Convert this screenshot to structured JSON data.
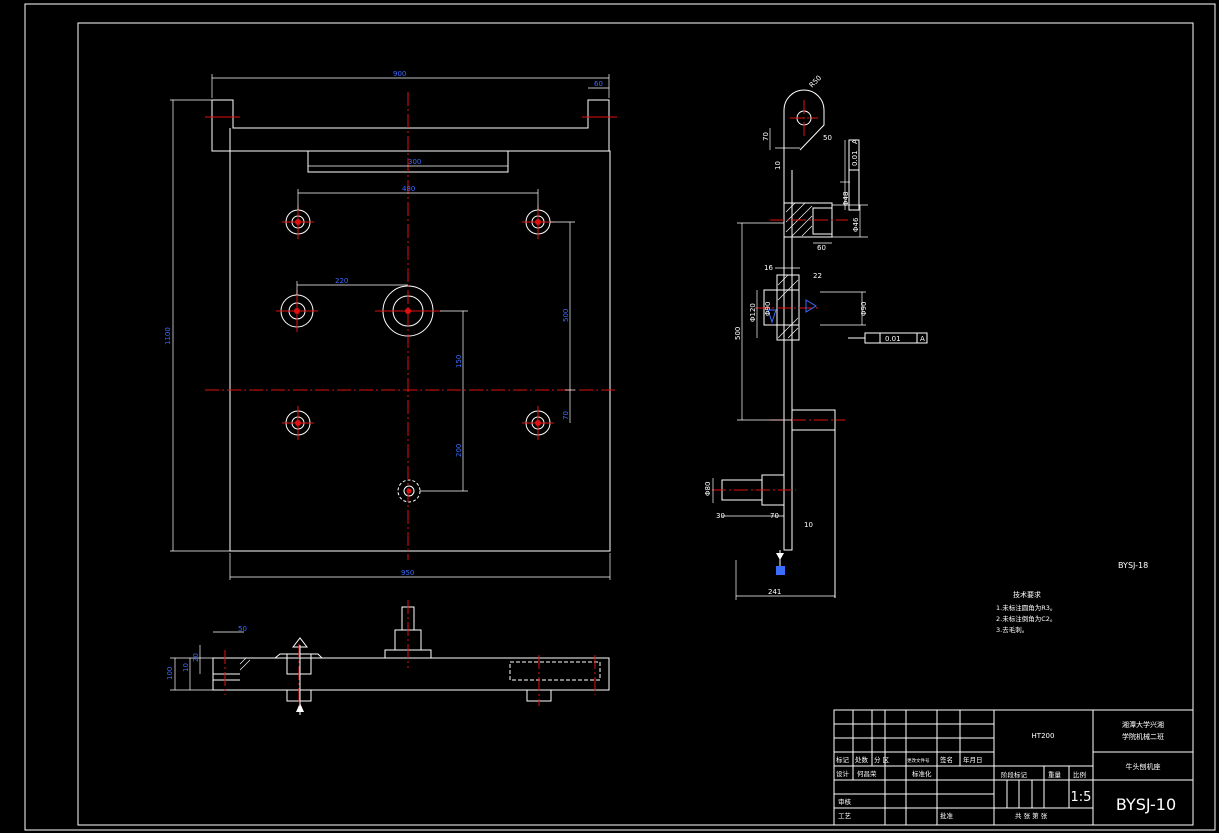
{
  "drawing": {
    "code_right": "BYSJ-18",
    "drawing_number": "BYSJ-10",
    "scale": "1:5",
    "material": "HT200",
    "part_name": "牛头刨机座",
    "school_line1": "湘潭大学兴湘",
    "school_line2": "学院机械二班"
  },
  "notes": {
    "title": "技术要求",
    "items": [
      "1.未标注圆角为R3。",
      "2.未标注倒角为C2。",
      "3.去毛刺。"
    ]
  },
  "title_block": {
    "row1": [
      "标记",
      "处数",
      "分 区",
      "更改文件号",
      "签名",
      "年月日"
    ],
    "row2": [
      "设计",
      "何昌荣",
      "标准化"
    ],
    "stage_headers": [
      "阶段标记",
      "重量",
      "比例"
    ],
    "review": "审核",
    "process": "工艺",
    "approve": "批准",
    "sheets": "共 张  第 张"
  },
  "dimensions": {
    "front_width_top": "900",
    "front_notch": "60",
    "front_width_bottom": "950",
    "front_height": "1100",
    "slot_width": "300",
    "hole_span": "480",
    "bore_offset": "220",
    "right_vert": "500",
    "right_small": "70",
    "mid_vert1": "150",
    "mid_vert2": "200"
  },
  "side_dims": {
    "r_top": "R50",
    "d70": "70",
    "d50": "50",
    "d10": "10",
    "d48": "Φ48",
    "d46": "Φ46",
    "d60": "60",
    "d16": "16",
    "d22": "22",
    "d120": "Φ120",
    "d90": "Φ90",
    "d500": "500",
    "d80": "Φ80",
    "d30": "30",
    "d70b": "70",
    "d10b": "10",
    "d241": "241",
    "tol1": "0.01",
    "tol_ref": "A",
    "tol2": "0.01"
  },
  "bottom_dims": {
    "b50": "50",
    "b20": "20",
    "b10": "10",
    "b100": "100"
  }
}
